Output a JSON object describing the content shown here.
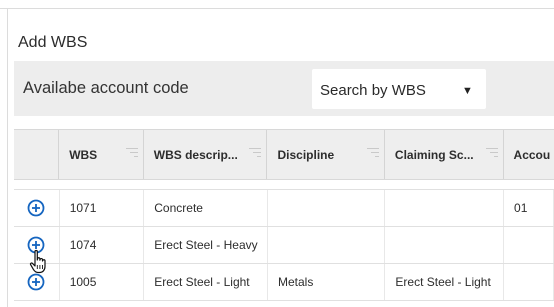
{
  "dialog": {
    "title": "Add WBS"
  },
  "account_bar": {
    "label": "Availabe account code",
    "search_select": {
      "value": "Search by WBS"
    }
  },
  "grid": {
    "columns": [
      {
        "label": ""
      },
      {
        "label": "WBS"
      },
      {
        "label": "WBS descrip..."
      },
      {
        "label": "Discipline"
      },
      {
        "label": "Claiming Sc..."
      },
      {
        "label": "Accou"
      }
    ],
    "rows": [
      {
        "wbs": "1071",
        "description": "Concrete",
        "discipline": "",
        "claiming": "",
        "account": "01"
      },
      {
        "wbs": "1074",
        "description": "Erect Steel - Heavy",
        "discipline": "",
        "claiming": "",
        "account": ""
      },
      {
        "wbs": "1005",
        "description": "Erect Steel - Light",
        "discipline": "Metals",
        "claiming": "Erect Steel - Light",
        "account": ""
      }
    ]
  },
  "colors": {
    "accent": "#1565c0",
    "header_bg": "#eeeeee",
    "bar_bg": "#ededed"
  },
  "icons": {
    "add": "plus-circle-icon",
    "cursor": "hand-pointer-icon",
    "filter": "filter-lines-icon",
    "dropdown": "caret-down-icon"
  }
}
